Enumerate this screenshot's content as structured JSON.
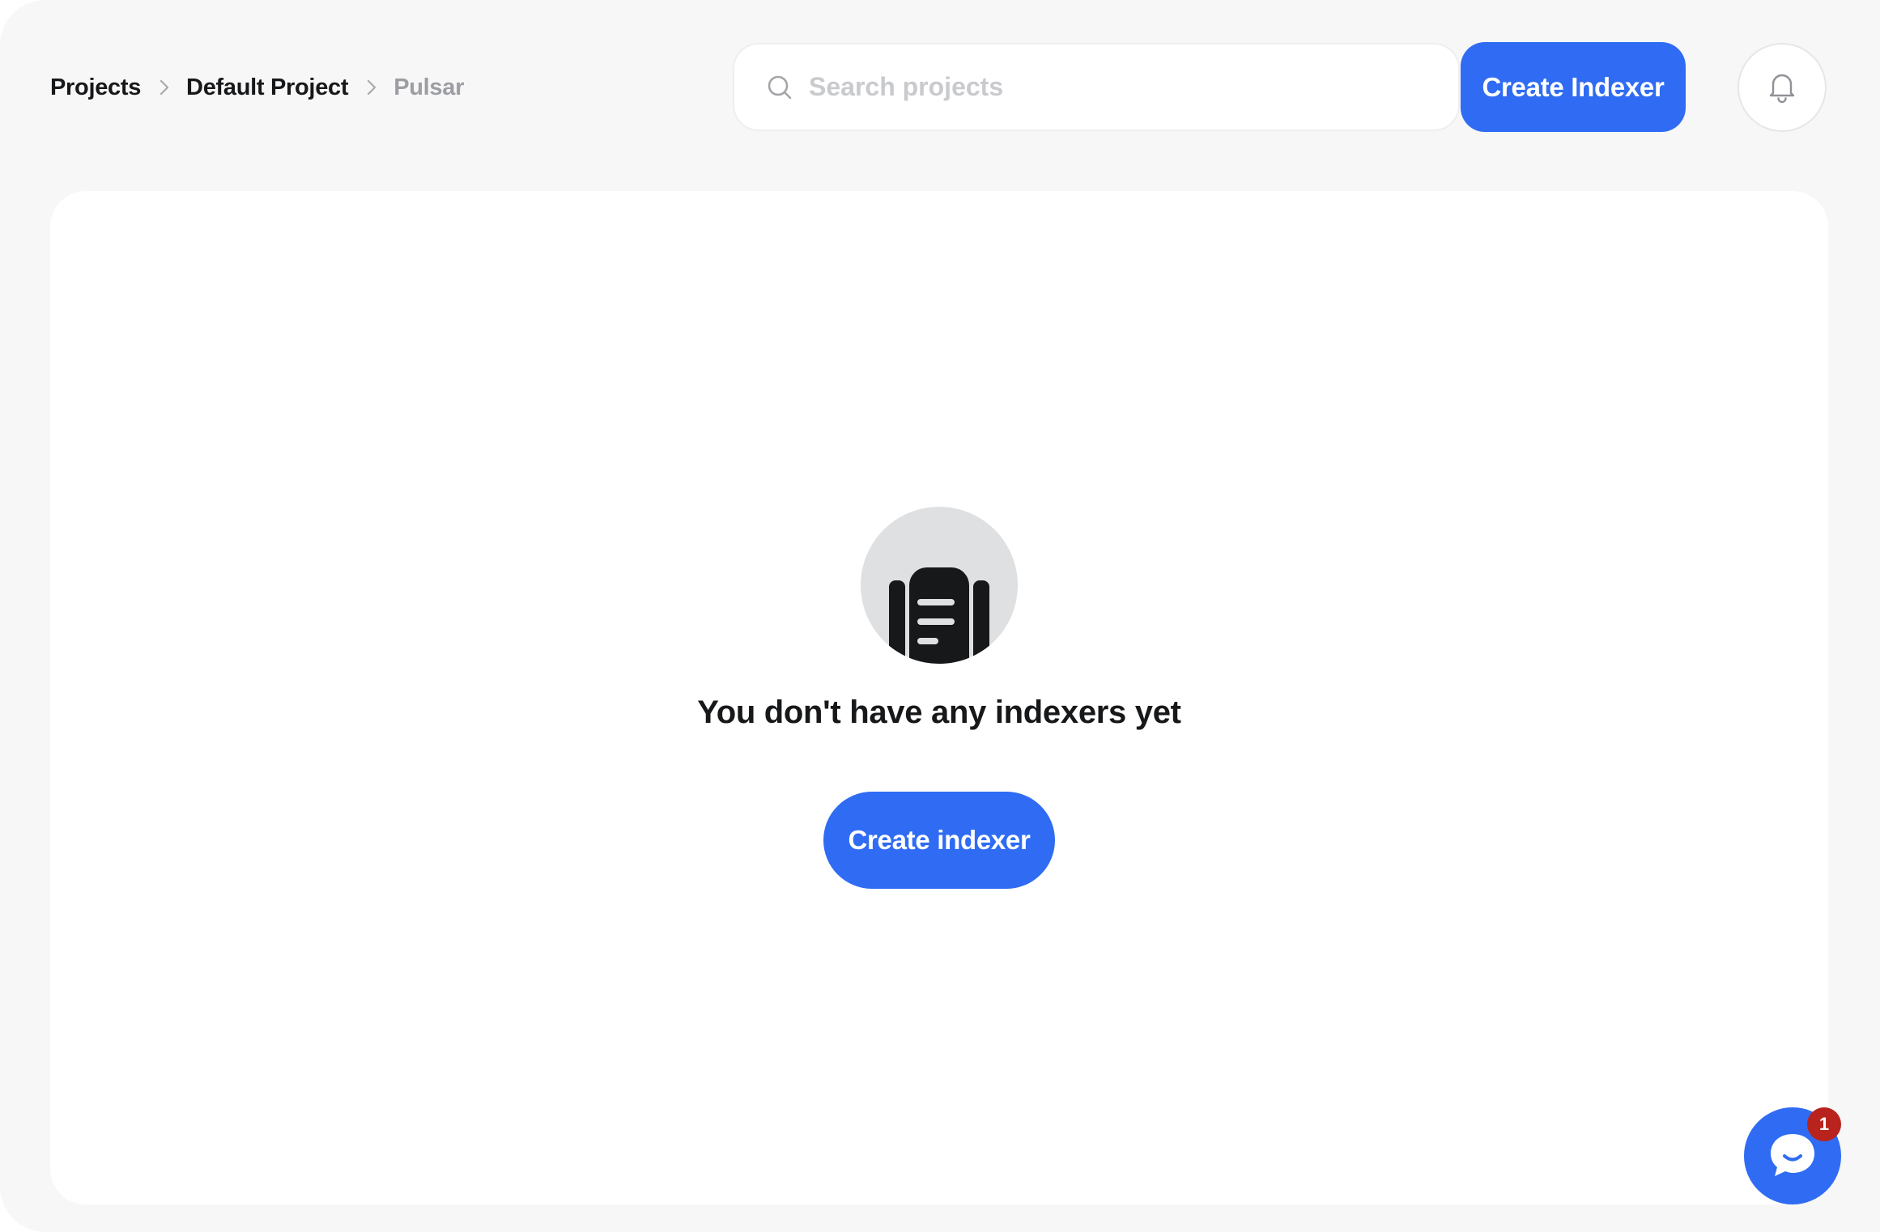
{
  "header": {
    "breadcrumb": {
      "items": [
        {
          "label": "Projects"
        },
        {
          "label": "Default Project"
        },
        {
          "label": "Pulsar"
        }
      ],
      "separator_icon": "chevron-right-icon"
    },
    "search": {
      "placeholder": "Search projects",
      "value": "",
      "icon": "search-icon"
    },
    "create_button_label": "Create Indexer",
    "notifications_icon": "bell-icon"
  },
  "main": {
    "empty_state": {
      "icon": "document-stack-icon",
      "title": "You don't have any indexers yet",
      "button_label": "Create indexer"
    }
  },
  "chat_widget": {
    "icon": "chat-bubble-icon",
    "badge_count": "1"
  },
  "colors": {
    "page_background": "#f7f7f7",
    "card_background": "#ffffff",
    "accent": "#2f6cf3",
    "text_primary": "#17181a",
    "text_muted": "#9c9ea3",
    "badge": "#b8231d"
  }
}
